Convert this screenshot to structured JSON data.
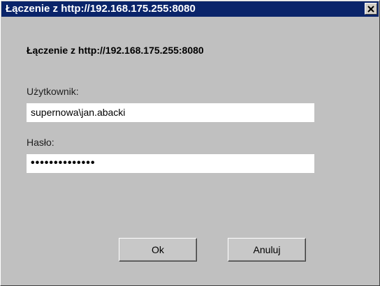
{
  "window": {
    "title": "Łączenie z http://192.168.175.255:8080",
    "close_icon": "close-icon"
  },
  "dialog": {
    "heading": "Łączenie z http://192.168.175.255:8080",
    "username_label": "Użytkownik:",
    "username_value": "supernowa\\jan.abacki",
    "password_label": "Hasło:",
    "password_value": "••••••••••••••",
    "ok_label": "Ok",
    "cancel_label": "Anuluj"
  },
  "colors": {
    "titlebar": "#0a246a",
    "dialog_background": "#c0c0c0",
    "field_background": "#ffffff"
  }
}
